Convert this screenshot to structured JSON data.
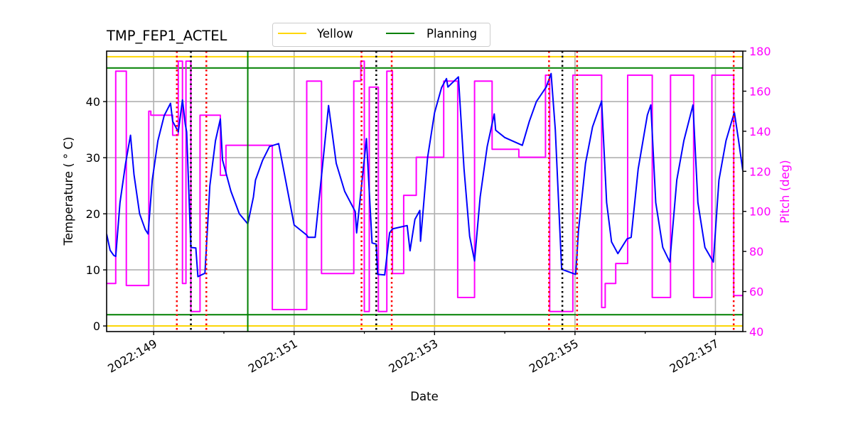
{
  "chart_data": {
    "type": "line",
    "title": "TMP_FEP1_ACTEL",
    "xlabel": "Date",
    "ylabel": "Temperature ($^\\circ$C)",
    "ylabel_display": "Temperature ( ° C)",
    "y2label": "Pitch (deg)",
    "xlim": [
      148.33,
      157.39
    ],
    "ylim": [
      -1,
      49
    ],
    "y2lim": [
      40,
      180
    ],
    "grid": true,
    "x_ticks": [
      {
        "value": 149,
        "label": "2022:149"
      },
      {
        "value": 151,
        "label": "2022:151"
      },
      {
        "value": 153,
        "label": "2022:153"
      },
      {
        "value": 155,
        "label": "2022:155"
      },
      {
        "value": 157,
        "label": "2022:157"
      }
    ],
    "x_minor_ticks": [
      150,
      152,
      154,
      156
    ],
    "y_ticks": [
      0,
      10,
      20,
      30,
      40
    ],
    "y2_ticks": [
      40,
      60,
      80,
      100,
      120,
      140,
      160,
      180
    ],
    "legend": {
      "placement": "top-center-above",
      "entries": [
        {
          "label": "Yellow",
          "color": "#ffd700"
        },
        {
          "label": "Planning",
          "color": "#008000"
        }
      ]
    },
    "limit_lines": [
      {
        "name": "yellow-high",
        "value": 48,
        "color": "#ffd700"
      },
      {
        "name": "yellow-low",
        "value": 0,
        "color": "#ffd700"
      },
      {
        "name": "planning-high",
        "value": 46,
        "color": "#008000"
      },
      {
        "name": "planning-low",
        "value": 2,
        "color": "#008000"
      }
    ],
    "vertical_lines": [
      {
        "x": 149.33,
        "color": "#ff0000",
        "style": "dotted"
      },
      {
        "x": 149.53,
        "color": "#000000",
        "style": "dotted"
      },
      {
        "x": 149.75,
        "color": "#ff0000",
        "style": "dotted"
      },
      {
        "x": 150.34,
        "color": "#008000",
        "style": "solid"
      },
      {
        "x": 151.96,
        "color": "#ff0000",
        "style": "dotted"
      },
      {
        "x": 152.17,
        "color": "#000000",
        "style": "dotted"
      },
      {
        "x": 152.39,
        "color": "#ff0000",
        "style": "dotted"
      },
      {
        "x": 154.63,
        "color": "#ff0000",
        "style": "dotted"
      },
      {
        "x": 154.82,
        "color": "#000000",
        "style": "dotted"
      },
      {
        "x": 155.03,
        "color": "#ff0000",
        "style": "dotted"
      },
      {
        "x": 157.26,
        "color": "#ff0000",
        "style": "dotted"
      }
    ],
    "series": [
      {
        "name": "Temperature",
        "axis": "left",
        "color": "#0000ff",
        "x": [
          148.33,
          148.38,
          148.43,
          148.46,
          148.52,
          148.6,
          148.67,
          148.72,
          148.8,
          148.88,
          148.92,
          148.98,
          149.06,
          149.15,
          149.24,
          149.27,
          149.35,
          149.41,
          149.45,
          149.47,
          149.53,
          149.6,
          149.63,
          149.73,
          149.8,
          149.88,
          149.95,
          149.98,
          150.1,
          150.22,
          150.34,
          150.42,
          150.45,
          150.55,
          150.65,
          150.78,
          151.0,
          151.18,
          151.2,
          151.3,
          151.4,
          151.49,
          151.6,
          151.72,
          151.87,
          151.89,
          151.96,
          152.03,
          152.11,
          152.17,
          152.19,
          152.29,
          152.36,
          152.4,
          152.5,
          152.61,
          152.65,
          152.72,
          152.79,
          152.8,
          152.9,
          153.0,
          153.1,
          153.17,
          153.19,
          153.34,
          153.42,
          153.5,
          153.57,
          153.65,
          153.75,
          153.85,
          153.87,
          154.0,
          154.25,
          154.35,
          154.45,
          154.59,
          154.66,
          154.72,
          154.81,
          155.01,
          155.05,
          155.15,
          155.25,
          155.38,
          155.45,
          155.52,
          155.61,
          155.74,
          155.8,
          155.9,
          156.03,
          156.08,
          156.15,
          156.25,
          156.35,
          156.45,
          156.55,
          156.68,
          156.75,
          156.85,
          156.97,
          157.05,
          157.15,
          157.27,
          157.33,
          157.39
        ],
        "y": [
          16.4,
          13.5,
          12.6,
          12.4,
          22,
          29,
          34,
          27,
          20,
          17.2,
          16.4,
          26,
          33,
          37.5,
          39.7,
          36.5,
          34.6,
          40.3,
          36,
          34.6,
          14,
          13.9,
          8.8,
          9.4,
          25,
          33,
          36.9,
          29.6,
          24,
          20,
          18.2,
          23,
          26,
          29.5,
          32,
          32.5,
          18,
          16.2,
          15.8,
          15.8,
          28,
          39.3,
          29,
          24,
          20.4,
          16.6,
          25,
          33.4,
          14.8,
          14.6,
          9.2,
          9.1,
          16.6,
          17.3,
          17.6,
          17.9,
          13.4,
          19,
          20.6,
          15.1,
          30,
          38,
          42.5,
          44.1,
          42.6,
          44.4,
          28,
          16,
          11.6,
          23,
          32,
          37.8,
          34.9,
          33.6,
          32.2,
          36.5,
          40,
          42.6,
          45,
          35,
          10.1,
          9.2,
          17,
          29,
          35.5,
          40.1,
          22,
          15,
          12.9,
          15.5,
          15.8,
          28,
          37.6,
          39.4,
          22,
          14,
          11.4,
          26,
          33,
          39.4,
          22,
          14,
          11.4,
          26,
          33,
          38.1,
          33,
          27.7
        ]
      },
      {
        "name": "Pitch",
        "axis": "right",
        "color": "#ff00ff",
        "x": [
          148.33,
          148.46,
          148.46,
          148.61,
          148.61,
          148.83,
          148.83,
          148.93,
          148.93,
          148.96,
          148.96,
          149.27,
          149.27,
          149.35,
          149.35,
          149.41,
          149.41,
          149.46,
          149.46,
          149.53,
          149.53,
          149.58,
          149.58,
          149.66,
          149.66,
          149.76,
          149.76,
          149.95,
          149.95,
          150.03,
          150.03,
          150.34,
          150.34,
          150.69,
          150.69,
          151.18,
          151.18,
          151.39,
          151.39,
          151.85,
          151.85,
          151.95,
          151.95,
          152.0,
          152.0,
          152.07,
          152.07,
          152.2,
          152.2,
          152.32,
          152.32,
          152.4,
          152.4,
          152.56,
          152.56,
          152.74,
          152.74,
          153.13,
          153.13,
          153.33,
          153.33,
          153.57,
          153.57,
          153.82,
          153.82,
          154.2,
          154.2,
          154.58,
          154.58,
          154.64,
          154.64,
          154.97,
          154.97,
          155.38,
          155.38,
          155.43,
          155.43,
          155.58,
          155.58,
          155.71,
          155.71,
          155.75,
          155.75,
          156.1,
          156.1,
          156.36,
          156.36,
          156.69,
          156.69,
          156.95,
          156.95,
          157.26,
          157.26,
          157.39
        ],
        "y": [
          64,
          64,
          170,
          170,
          63,
          63,
          63,
          63,
          150,
          150,
          148,
          148,
          138,
          138,
          175,
          175,
          64,
          64,
          175,
          175,
          50,
          50,
          50,
          50,
          148,
          148,
          148,
          148,
          118,
          118,
          133,
          133,
          133,
          133,
          51,
          51,
          165,
          165,
          69,
          69,
          165,
          165,
          175,
          175,
          50,
          50,
          162,
          162,
          50,
          50,
          170,
          170,
          69,
          69,
          108,
          108,
          127,
          127,
          165,
          165,
          57,
          57,
          165,
          165,
          131,
          131,
          127,
          127,
          168,
          168,
          50,
          50,
          168,
          168,
          52,
          52,
          64,
          64,
          74,
          74,
          74,
          74,
          168,
          168,
          57,
          57,
          168,
          168,
          57,
          57,
          168,
          168,
          58,
          58
        ]
      }
    ]
  }
}
